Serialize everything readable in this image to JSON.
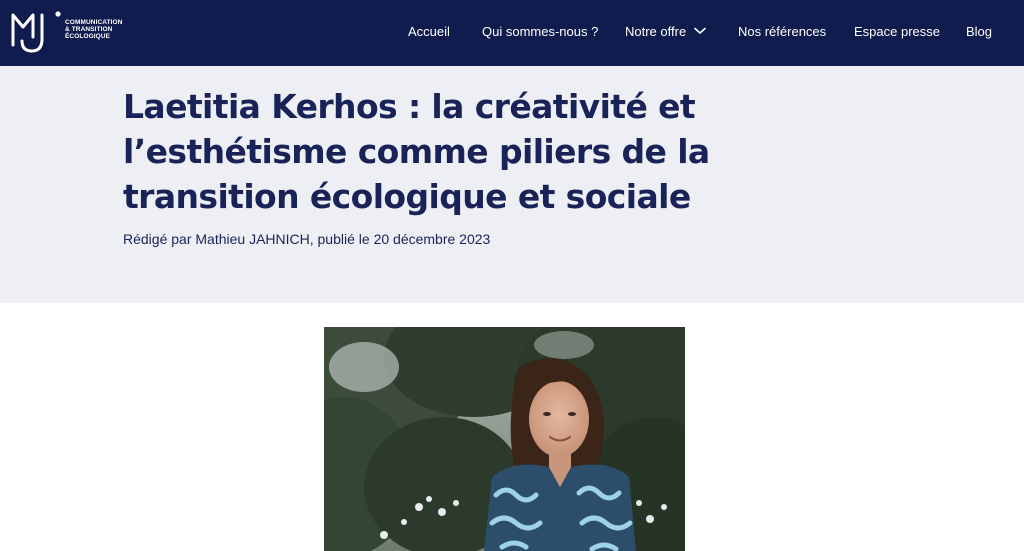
{
  "header": {
    "logo": {
      "monogram": "MJ",
      "tagline_lines": [
        "COMMUNICATION",
        "& TRANSITION",
        "ÉCOLOGIQUE"
      ]
    },
    "nav": [
      {
        "label": "Accueil"
      },
      {
        "label": "Qui sommes-nous ?"
      },
      {
        "label": "Notre offre",
        "icon": "chevron-down-icon"
      },
      {
        "label": "Nos références"
      },
      {
        "label": "Espace presse"
      },
      {
        "label": "Blog"
      }
    ]
  },
  "article": {
    "title": "Laetitia Kerhos : la créativité et l’esthétisme comme piliers de la transition écologique et sociale",
    "byline": "Rédigé par Mathieu JAHNICH, publié le 20 décembre 2023",
    "photo": {
      "subject": "portrait-photo"
    }
  },
  "colors": {
    "navy": "#0f1c4d",
    "title": "#1a2358",
    "hero_bg": "#eeeff5",
    "white": "#ffffff"
  }
}
